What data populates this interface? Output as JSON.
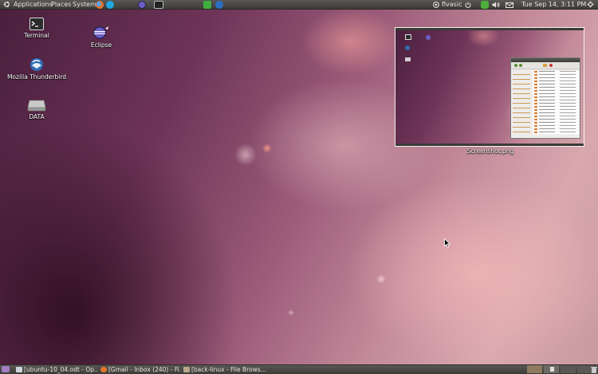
{
  "top_panel": {
    "menus": [
      "Applications",
      "Places",
      "System"
    ],
    "user": "flvasic",
    "datetime": "Tue Sep 14,  3:11 PM"
  },
  "desktop_icons": [
    {
      "label": "Terminal",
      "icon": "terminal-icon"
    },
    {
      "label": "Mozilla Thunderbird",
      "icon": "thunderbird-icon"
    },
    {
      "label": "DATA",
      "icon": "drive-icon"
    },
    {
      "label": "Eclipse",
      "icon": "eclipse-icon"
    }
  ],
  "thumbnail": {
    "caption": "Screenshot.png"
  },
  "taskbar": {
    "tasks": [
      {
        "label": "[ubuntu-10_04.odt - Op..."
      },
      {
        "label": "[Gmail - Inbox (240) - Fi..."
      },
      {
        "label": "[back-linux - File Brows..."
      }
    ]
  },
  "colors": {
    "panel": "#3c3b37",
    "accent": "#dd4814"
  }
}
